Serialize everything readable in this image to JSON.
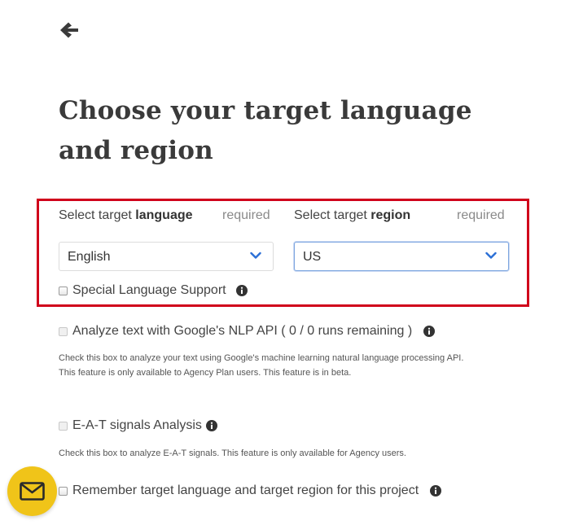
{
  "page": {
    "title": "Choose your target language and region"
  },
  "language": {
    "label_prefix": "Select target ",
    "label_strong": "language",
    "required": "required",
    "selected": "English"
  },
  "region": {
    "label_prefix": "Select target ",
    "label_strong": "region",
    "required": "required",
    "selected": "US"
  },
  "options": {
    "special_language": "Special Language Support",
    "nlp": "Analyze text with Google's NLP API ( 0 / 0 runs remaining )",
    "nlp_help_1": "Check this box to analyze your text using Google's machine learning natural language processing API.",
    "nlp_help_2": "This feature is only available to Agency Plan users. This feature is in beta.",
    "eat": "E-A-T signals Analysis",
    "eat_help": "Check this box to analyze E-A-T signals. This feature is only available for Agency users.",
    "remember": "Remember target language and target region for this project"
  },
  "colors": {
    "highlight_border": "#d0021b",
    "fab": "#f0c419",
    "chevron": "#2b6fd6",
    "text": "#333333"
  },
  "icons": {
    "back": "arrow-left-icon",
    "chevron": "chevron-down-icon",
    "info": "info-circle-icon",
    "mail": "envelope-icon"
  }
}
